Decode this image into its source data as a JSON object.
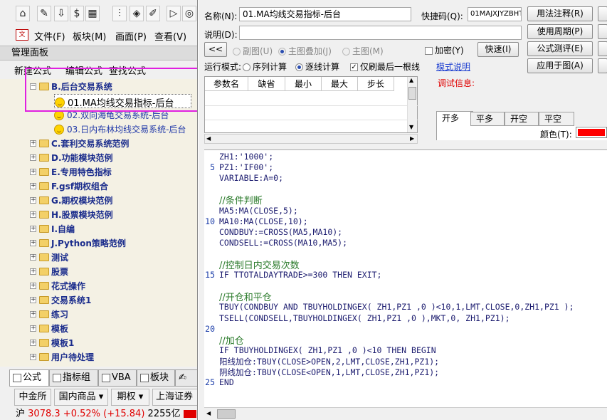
{
  "left": {
    "menu": [
      "文件(F)",
      "板块(M)",
      "画面(P)",
      "查看(V)"
    ],
    "panel_title": "管理面板",
    "quick_links": [
      "新建公式",
      "编辑公式",
      "查找公式"
    ],
    "tree": {
      "root": "B.后台交易系统",
      "children": [
        "01.MA均线交易指标-后台",
        "02.双向海龟交易系统-后台",
        "03.日内布林均线交易系统-后台"
      ],
      "folders": [
        "C.套利交易系统范例",
        "D.功能模块范例",
        "E.专用特色指标",
        "F.gsf期权组合",
        "G.期权模块范例",
        "H.股票模块范例",
        "I.自编",
        "J.Python策略范例",
        "测试",
        "股票",
        "花式操作",
        "交易系统1",
        "练习",
        "模板",
        "模板1",
        "用户待处理"
      ]
    },
    "bottom_tabs": [
      "公式",
      "指标组",
      "VBA",
      "板块"
    ],
    "markets": [
      "中金所",
      "国内商品",
      "期权",
      "上海证券"
    ],
    "status": {
      "index": "沪",
      "price": "3078.3",
      "change_pct": "+0.52%",
      "change": "(+15.84)",
      "volume": "2255亿"
    }
  },
  "editor": {
    "name_label": "名称(N):",
    "name_value": "01.MA均线交易指标-后台",
    "shortcut_label": "快捷码(Q):",
    "shortcut_value": "01MAJXJYZBHT",
    "desc_label": "说明(D):",
    "btn_usage": "用法注释(R)",
    "btn_period": "使用周期(P)",
    "btn_test": "公式测评(E)",
    "btn_apply": "应用于图(A)",
    "btn_back": "<<",
    "radio_sub": "副图(U)",
    "radio_main_overlay": "主图叠加(J)",
    "radio_main": "主图(M)",
    "encrypt_label": "加密(Y)",
    "btn_fast": "快速(I)",
    "run_mode_label": "运行模式:",
    "radio_sequence": "序列计算",
    "radio_tick": "逐线计算",
    "refresh_last": "仅刷最后一根线",
    "mode_desc_link": "模式说明",
    "debug_label": "调试信息:",
    "param_headers": [
      "参数名",
      "缺省",
      "最小",
      "最大",
      "步长"
    ],
    "pos_tabs": [
      "开多",
      "平多",
      "开空",
      "平空"
    ],
    "color_label": "颜色(T):",
    "color_value": "#ff0000"
  },
  "code": [
    {
      "n": "",
      "t": "ZH1:'1000';"
    },
    {
      "n": "5",
      "t": "PZ1:'IF00';"
    },
    {
      "n": "",
      "t": "VARIABLE:A=0;"
    },
    {
      "n": "",
      "t": ""
    },
    {
      "n": "",
      "t": "//条件判断",
      "c": true
    },
    {
      "n": "",
      "t": "MA5:MA(CLOSE,5);"
    },
    {
      "n": "10",
      "t": "MA10:MA(CLOSE,10);"
    },
    {
      "n": "",
      "t": "CONDBUY:=CROSS(MA5,MA10);"
    },
    {
      "n": "",
      "t": "CONDSELL:=CROSS(MA10,MA5);"
    },
    {
      "n": "",
      "t": ""
    },
    {
      "n": "",
      "t": "//控制日内交易次数",
      "c": true
    },
    {
      "n": "15",
      "t": "IF TTOTALDAYTRADE>=300 THEN EXIT;"
    },
    {
      "n": "",
      "t": ""
    },
    {
      "n": "",
      "t": "//开仓和平仓",
      "c": true
    },
    {
      "n": "",
      "t": "TBUY(CONDBUY AND TBUYHOLDINGEX( ZH1,PZ1 ,0 )<10,1,LMT,CLOSE,0,ZH1,PZ1 );"
    },
    {
      "n": "",
      "t": "TSELL(CONDSELL,TBUYHOLDINGEX( ZH1,PZ1 ,0 ),MKT,0, ZH1,PZ1);"
    },
    {
      "n": "20",
      "t": ""
    },
    {
      "n": "",
      "t": "//加仓",
      "c": true
    },
    {
      "n": "",
      "t": "IF TBUYHOLDINGEX( ZH1,PZ1 ,0 )<10 THEN BEGIN"
    },
    {
      "n": "",
      "t": "阳线加仓:TBUY(CLOSE>OPEN,2,LMT,CLOSE,ZH1,PZ1);"
    },
    {
      "n": "",
      "t": "阴线加仓:TBUY(CLOSE<OPEN,1,LMT,CLOSE,ZH1,PZ1);"
    },
    {
      "n": "25",
      "t": "END"
    }
  ]
}
